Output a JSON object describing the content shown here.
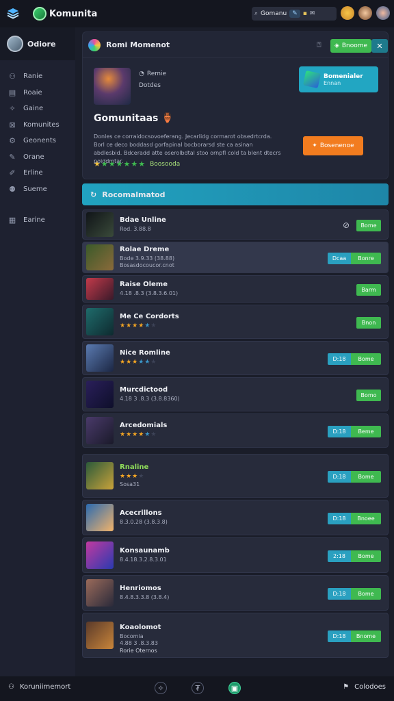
{
  "topbar": {
    "app_name": "Komunita",
    "search_label": "Gomanu",
    "search_badge": "✎",
    "icons": [
      "layers-icon",
      "controller-icon",
      "mail-icon",
      "emoji-avatar",
      "user-avatar",
      "profile-avatar"
    ]
  },
  "sidebar": {
    "user_name": "Odiore",
    "items": [
      {
        "label": "Ranie",
        "icon": "people-icon"
      },
      {
        "label": "Roaie",
        "icon": "board-icon"
      },
      {
        "label": "Gaine",
        "icon": "gamepad-icon"
      },
      {
        "label": "Komunites",
        "icon": "comment-icon"
      },
      {
        "label": "Geonents",
        "icon": "settings-icon"
      },
      {
        "label": "Orane",
        "icon": "pen-icon"
      },
      {
        "label": "Erline",
        "icon": "edit-icon"
      },
      {
        "label": "Sueme",
        "icon": "group-icon"
      },
      {
        "label": "Earine",
        "icon": "grid-icon"
      }
    ]
  },
  "header_card": {
    "title": "Romi Momenot",
    "green_button": "Bnoome",
    "meta1": "Remie",
    "meta2": "Dotdes",
    "game_name": "Gomunitaas",
    "game_emoji": "🏺",
    "description": "Donles ce corraidocsovoeferang. Jecarlidg cormarot obsedrtcrda. Borl ce deco boddasd gorfapinal bocborarsd ste ca asinan abdlesbid. Bdceradd atte oserolbdtal stoo ornpfl cold ta blent dtecrs poiddmtar.",
    "rating_text": "Boosooda",
    "teal_card": {
      "line1": "Bomenialer",
      "line2": "Ennan"
    },
    "orange_button": "Bosenenoe"
  },
  "recommend_bar": {
    "label": "Rocomalmatod"
  },
  "games": [
    {
      "title": "Bdae Unline",
      "sub": "Rod. 3.88.8",
      "action": "play",
      "play": "Bome",
      "link": true,
      "stars": null
    },
    {
      "title": "Rolae Dreme",
      "sub": "Bode 3.9.33 (38.88)\nBosasdocoucor.cnot",
      "action": "pair",
      "a": "Dcaa",
      "b": "Bonre",
      "stars": null,
      "selected": true
    },
    {
      "title": "Raise Oleme",
      "sub": "4.18 .8.3 (3.8.3.6.01)",
      "action": "play",
      "play": "Barm",
      "stars": null
    },
    {
      "title": "Me Ce Cordorts",
      "sub": "",
      "action": "play",
      "play": "Bnon",
      "stars": {
        "orange": 4,
        "blue": 1,
        "grey": 1
      }
    },
    {
      "title": "Nice Romline",
      "sub": "",
      "action": "pair",
      "a": "D:18",
      "b": "Bome",
      "stars": {
        "orange": 3,
        "blue": 2,
        "grey": 1
      }
    },
    {
      "title": "Murcdictood",
      "sub": "4.18 3 .8.3 (3.8.8360)",
      "action": "play",
      "play": "Bomo",
      "stars": null
    },
    {
      "title": "Arcedomials",
      "sub": "",
      "action": "pair",
      "a": "D:18",
      "b": "Beme",
      "stars": {
        "orange": 4,
        "blue": 1,
        "grey": 1
      }
    },
    {
      "title": "Rnaline",
      "sub": "Sosa31",
      "action": "pair",
      "a": "D:18",
      "b": "Bome",
      "stars": {
        "orange": 3,
        "blue": 0,
        "grey": 1
      }
    },
    {
      "title": "Acecrillons",
      "sub": "8.3.0.28 (3.8.3.8)",
      "action": "pair",
      "a": "D:18",
      "b": "Bnoee",
      "stars": null
    },
    {
      "title": "Konsaunamb",
      "sub": "8.4.18.3.2.8.3.01",
      "action": "pair",
      "a": "2:18",
      "b": "Bome",
      "stars": null
    },
    {
      "title": "Henriomos",
      "sub": "8.4.8.3.3.8 (3.8.4)",
      "action": "pair",
      "a": "D:18",
      "b": "Bome",
      "stars": null
    },
    {
      "title": "Koaolomot",
      "sub": "Bocomia\n4.88 3 .8.3.83",
      "action": "pair",
      "a": "D:18",
      "b": "Bnome",
      "stars": null,
      "footer": "Rorie Oternos"
    }
  ],
  "bottombar": {
    "left_label": "Koruniimemort",
    "right_label": "Colodoes",
    "icons": [
      "compass-icon",
      "currency-icon",
      "home-icon"
    ]
  }
}
